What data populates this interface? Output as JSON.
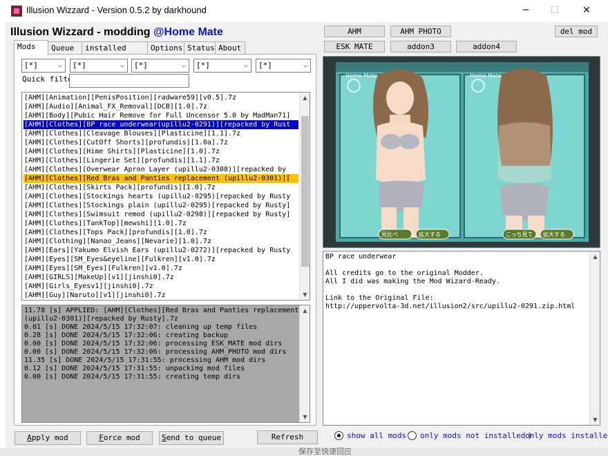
{
  "window": {
    "title": "Illusion Wizzard - Version 0.5.2 by darkhound",
    "minimize_glyph": "─",
    "maximize_glyph": "☐",
    "close_glyph": "✕"
  },
  "heading": {
    "main": "Illusion Wizzard - modding ",
    "accent": "@Home Mate",
    "accent_color": "#1010c8"
  },
  "tabs": [
    "Mods",
    "Queue",
    "installed Mods",
    "Options",
    "Status",
    "About"
  ],
  "filters": {
    "combos": [
      "[*]",
      "[*]",
      "[*]",
      "[*]",
      "[*]"
    ],
    "quick_filter_label": "Quick filter",
    "quick_filter_value": ""
  },
  "mod_list": [
    "[AHM][Animation][PenisPosition][radware59][v0.5].7z",
    "[AHM][Audio][Animal_FX_Removal][DCB][1.0].7z",
    "[AHM][Body][Pubic Hair Remove for Full Uncensor 5.0 by MadMan71]",
    "[AHM][Clothes][BP race underwear(upillu2-0291)][repacked by Rust",
    "[AHM][Clothes][Cleavage Blouses][Plasticine][1.1].7z",
    "[AHM][Clothes][CutOff Shorts][profundis][1.0a].7z",
    "[AHM][Clothes][Hime Shirts][Plasticine][1.0].7z",
    "[AHM][Clothes][Lingerie Set][profundis][1.1].7z",
    "[AHM][Clothes][Overwear Apron Layer (upillu2-0308)][repacked by",
    "[AHM][Clothes][Red Bras and Panties replacement (upillu2-0301)][",
    "[AHM][Clothes][Skirts Pack][profundis][1.0].7z",
    "[AHM][Clothes][Stockings hearts (upillu2-0295)[repacked by Rusty",
    "[AHM][Clothes][Stockings plain (upillu2-0295)[repacked by Rusty]",
    "[AHM][Clothes][Swimsuit remod (upillu2-0298)][repacked by Rusty]",
    "[AHM][Clothes][TankTop][mewshi][1.0].7z",
    "[AHM][Clothes][Tops Pack][profundis][1.0].7z",
    "[AHM][Clothing][Nanao_Jeans][Nevarie][1.0].7z",
    "[AHM][Ears][Yakumo Elvish Ears (upillu2-0272)][repacked by Rusty",
    "[AHM][Eyes][SM_Eyes&eyeline][Fulkren][v1.0].7z",
    "[AHM][Eyes][SM_Eyes][Fulkren][v1.0].7z",
    "[AHM][GIRLS][MakeUp][v1][jinshi0].7z",
    "[AHM][Girls_Eyesv1][jinshi0].7z",
    "[AHM][Guy][Naruto][v1][jinshi0].7z"
  ],
  "mod_list_selected_index": 3,
  "mod_list_highlight_index": 9,
  "selection_color": "#0000c8",
  "highlight_color": "#ffc000",
  "log": [
    "11.78 [s] APPLIED: [AHM][Clothes][Red Bras and Panties replacement (upillu2-0301)][repacked by Rusty].7z",
    "0.01 [s] DONE 2024/5/15 17:32:07: cleaning up temp files",
    "0.28 [s] DONE 2024/5/15 17:32:06: creating backup",
    "0.00 [s] DONE 2024/5/15 17:32:06: processing ESK_MATE mod dirs",
    "0.00 [s] DONE 2024/5/15 17:32:06: processing AHM_PHOTO mod dirs",
    "11.35 [s] DONE 2024/5/15 17:31:55: processing AHM mod dirs",
    "0.12 [s] DONE 2024/5/15 17:31:55: unpacking mod files",
    "0.00 [s] DONE 2024/5/15 17:31:55: creating temp dirs"
  ],
  "bottom_buttons": {
    "apply": {
      "first": "A",
      "rest": "pply mod"
    },
    "force": {
      "first": "F",
      "rest": "orce mod"
    },
    "send": {
      "first": "S",
      "rest": "end to queue"
    },
    "refresh": "Refresh"
  },
  "game_buttons": [
    "AHM",
    "AHM PHOTO",
    "ESK MATE",
    "addon3",
    "addon4"
  ],
  "del_mod_label": "del mod",
  "preview": {
    "left_logo": "Home Mate",
    "right_logo": "Home Mate",
    "ui_buttons": [
      "見比べ",
      "拡大する",
      "こっち見て",
      "拡大する"
    ]
  },
  "description": [
    "BP race underwear",
    "",
    "All credits go to the original Modder.",
    "All I did was making the Mod Wizard-Ready.",
    "",
    "Link to the Original File:",
    "http://uppervolta-3d.net/illusion2/src/upillu2-0291.zip.html"
  ],
  "radio_options": [
    "show all mods",
    "only mods not installed",
    "only mods installe"
  ],
  "radio_selected": 0,
  "taskbar_hint": "保存至快速回应"
}
